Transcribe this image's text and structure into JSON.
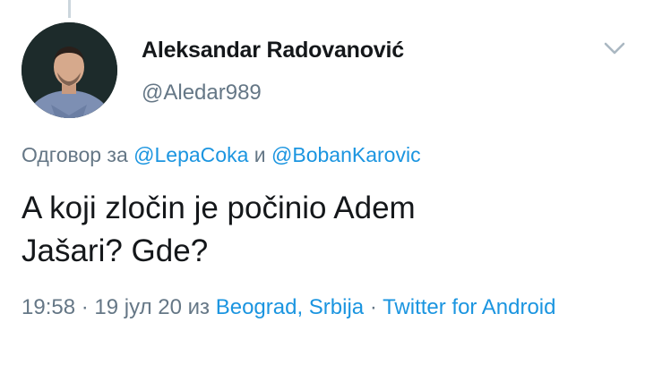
{
  "tweet": {
    "author": {
      "display_name": "Aleksandar Radovanović",
      "handle": "@Aledar989"
    },
    "reply": {
      "prefix": "Одговор за",
      "mention_1": "@LepaCoka",
      "conjunction": "и",
      "mention_2": "@BobanKarovic"
    },
    "text_line_1": "A koji zločin je počinio Adem",
    "text_line_2": "Jašari? Gde?",
    "meta": {
      "time": "19:58",
      "sep1": "·",
      "date": "19 јул 20",
      "from": "из",
      "location": "Beograd, Srbija",
      "sep2": "·",
      "source": "Twitter for Android"
    }
  },
  "icons": {
    "more": "chevron-down-icon",
    "avatar": "avatar-photo"
  },
  "colors": {
    "link": "#1b95e0",
    "secondary": "#657786",
    "primary_text": "#14171a",
    "thread_line": "#ccd6dd"
  }
}
